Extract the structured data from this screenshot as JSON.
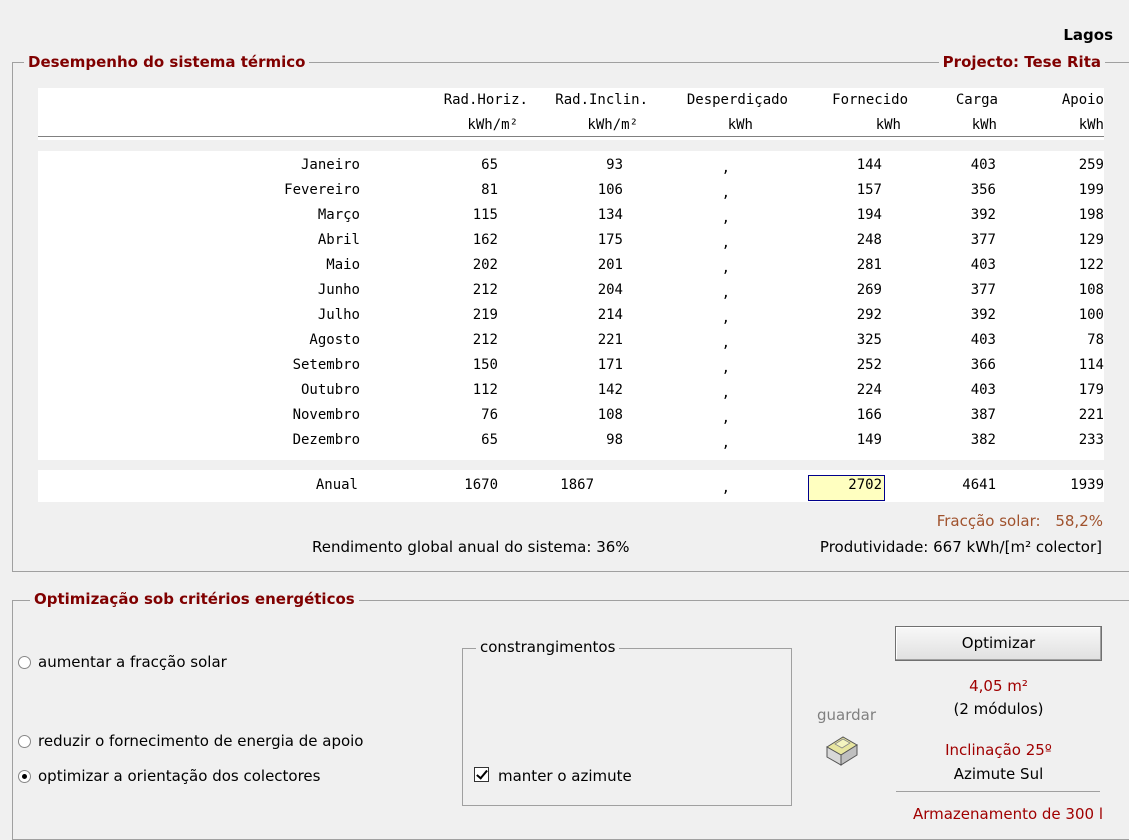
{
  "location": "Lagos",
  "performance": {
    "title": "Desempenho do sistema térmico",
    "project": "Projecto: Tese Rita",
    "columns": [
      "Rad.Horiz.",
      "Rad.Inclin.",
      "Desperdiçado",
      "Fornecido",
      "Carga",
      "Apoio"
    ],
    "units": [
      "kWh/m²",
      "kWh/m²",
      "kWh",
      "kWh",
      "kWh",
      "kWh"
    ],
    "rows": [
      {
        "month": "Janeiro",
        "values": [
          "65",
          "93",
          ",",
          "144",
          "403",
          "259"
        ]
      },
      {
        "month": "Fevereiro",
        "values": [
          "81",
          "106",
          ",",
          "157",
          "356",
          "199"
        ]
      },
      {
        "month": "Março",
        "values": [
          "115",
          "134",
          ",",
          "194",
          "392",
          "198"
        ]
      },
      {
        "month": "Abril",
        "values": [
          "162",
          "175",
          ",",
          "248",
          "377",
          "129"
        ]
      },
      {
        "month": "Maio",
        "values": [
          "202",
          "201",
          ",",
          "281",
          "403",
          "122"
        ]
      },
      {
        "month": "Junho",
        "values": [
          "212",
          "204",
          ",",
          "269",
          "377",
          "108"
        ]
      },
      {
        "month": "Julho",
        "values": [
          "219",
          "214",
          ",",
          "292",
          "392",
          "100"
        ]
      },
      {
        "month": "Agosto",
        "values": [
          "212",
          "221",
          ",",
          "325",
          "403",
          "78"
        ]
      },
      {
        "month": "Setembro",
        "values": [
          "150",
          "171",
          ",",
          "252",
          "366",
          "114"
        ]
      },
      {
        "month": "Outubro",
        "values": [
          "112",
          "142",
          ",",
          "224",
          "403",
          "179"
        ]
      },
      {
        "month": "Novembro",
        "values": [
          "76",
          "108",
          ",",
          "166",
          "387",
          "221"
        ]
      },
      {
        "month": "Dezembro",
        "values": [
          "65",
          "98",
          ",",
          "149",
          "382",
          "233"
        ]
      }
    ],
    "annual": {
      "label": "Anual",
      "values": [
        "1670",
        "1867",
        ",",
        "2702",
        "4641",
        "1939"
      ]
    },
    "solar_fraction_label": "Fracção solar:",
    "solar_fraction_value": "58,2%",
    "global_efficiency": "Rendimento global anual do sistema: 36%",
    "productivity": "Produtividade: 667 kWh/[m² colector]"
  },
  "optimization": {
    "title": "Optimização sob critérios energéticos",
    "options": [
      {
        "label": "aumentar a fracção solar",
        "selected": false
      },
      {
        "label": "reduzir o fornecimento de energia de apoio",
        "selected": false
      },
      {
        "label": "optimizar a orientação dos colectores",
        "selected": true
      }
    ],
    "constraints_title": "constrangimentos",
    "keep_azimuth_label": "manter o azimute",
    "keep_azimuth_checked": true,
    "save_label": "guardar",
    "button_label": "Optimizar",
    "area": "4,05 m²",
    "modules": "(2 módulos)",
    "inclination": "Inclinação 25º",
    "azimuth": "Azimute Sul",
    "storage": "Armazenamento de 300 l"
  },
  "colors": {
    "accent": "#800000",
    "highlight": "#ffffc0",
    "fraction": "#a0522d"
  }
}
